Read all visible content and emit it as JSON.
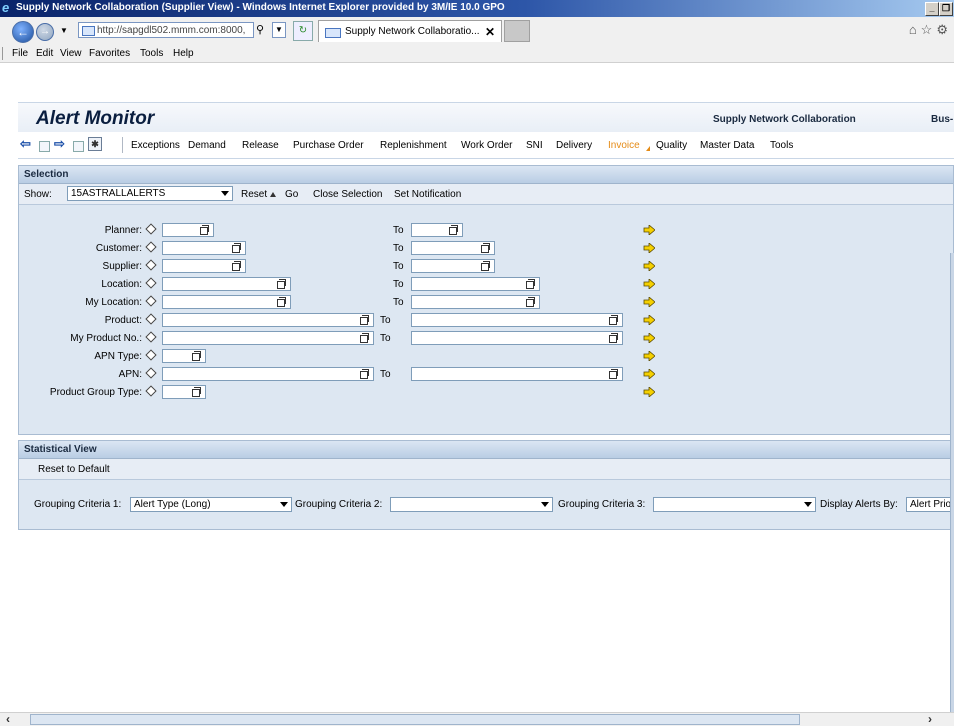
{
  "window": {
    "title": "Supply Network Collaboration (Supplier View) - Windows Internet Explorer provided by 3M/IE 10.0 GPO",
    "buttons": [
      "_",
      "❐"
    ]
  },
  "browser": {
    "address": "http://sapgdl502.mmm.com:8000,",
    "tab_title": "Supply Network Collaboratio...",
    "tab_close": "✕"
  },
  "menu": [
    "File",
    "Edit",
    "View",
    "Favorites",
    "Tools",
    "Help"
  ],
  "app": {
    "title": "Alert Monitor",
    "product": "Supply Network Collaboration",
    "bus": "Bus-"
  },
  "nav_menu": [
    {
      "label": "Exceptions"
    },
    {
      "label": "Demand"
    },
    {
      "label": "Release"
    },
    {
      "label": "Purchase Order"
    },
    {
      "label": "Replenishment"
    },
    {
      "label": "Work Order"
    },
    {
      "label": "SNI"
    },
    {
      "label": "Delivery"
    },
    {
      "label": "Invoice",
      "highlight": true
    },
    {
      "label": "Quality"
    },
    {
      "label": "Master Data"
    },
    {
      "label": "Tools"
    }
  ],
  "selection": {
    "header": "Selection",
    "show_label": "Show:",
    "show_value": "15ASTRALLALERTS",
    "reset": "Reset",
    "go": "Go",
    "close_selection": "Close Selection",
    "set_notification": "Set Notification",
    "to_label": "To",
    "fields": [
      {
        "label": "Planner:",
        "value": "",
        "to_value": "",
        "has_to": true
      },
      {
        "label": "Customer:",
        "value": "",
        "to_value": "",
        "has_to": true
      },
      {
        "label": "Supplier:",
        "value": "",
        "to_value": "",
        "has_to": true
      },
      {
        "label": "Location:",
        "value": "",
        "to_value": "",
        "has_to": true
      },
      {
        "label": "My Location:",
        "value": "",
        "to_value": "",
        "has_to": true
      },
      {
        "label": "Product:",
        "value": "",
        "to_value": "",
        "has_to": true
      },
      {
        "label": "My Product No.:",
        "value": "",
        "to_value": "",
        "has_to": true
      },
      {
        "label": "APN Type:",
        "value": "",
        "has_to": false
      },
      {
        "label": "APN:",
        "value": "",
        "to_value": "",
        "has_to": true
      },
      {
        "label": "Product Group Type:",
        "value": "",
        "has_to": false
      }
    ]
  },
  "statistical": {
    "header": "Statistical View",
    "reset_default": "Reset to Default",
    "grouping1_label": "Grouping Criteria 1:",
    "grouping1_value": "Alert Type (Long)",
    "grouping2_label": "Grouping Criteria 2:",
    "grouping2_value": "",
    "grouping3_label": "Grouping Criteria 3:",
    "grouping3_value": "",
    "display_label": "Display Alerts By:",
    "display_value": "Alert Prio"
  },
  "colors": {
    "highlight": "#e58c18",
    "panel": "#dde7f2",
    "title_bar": "#0a246a"
  }
}
